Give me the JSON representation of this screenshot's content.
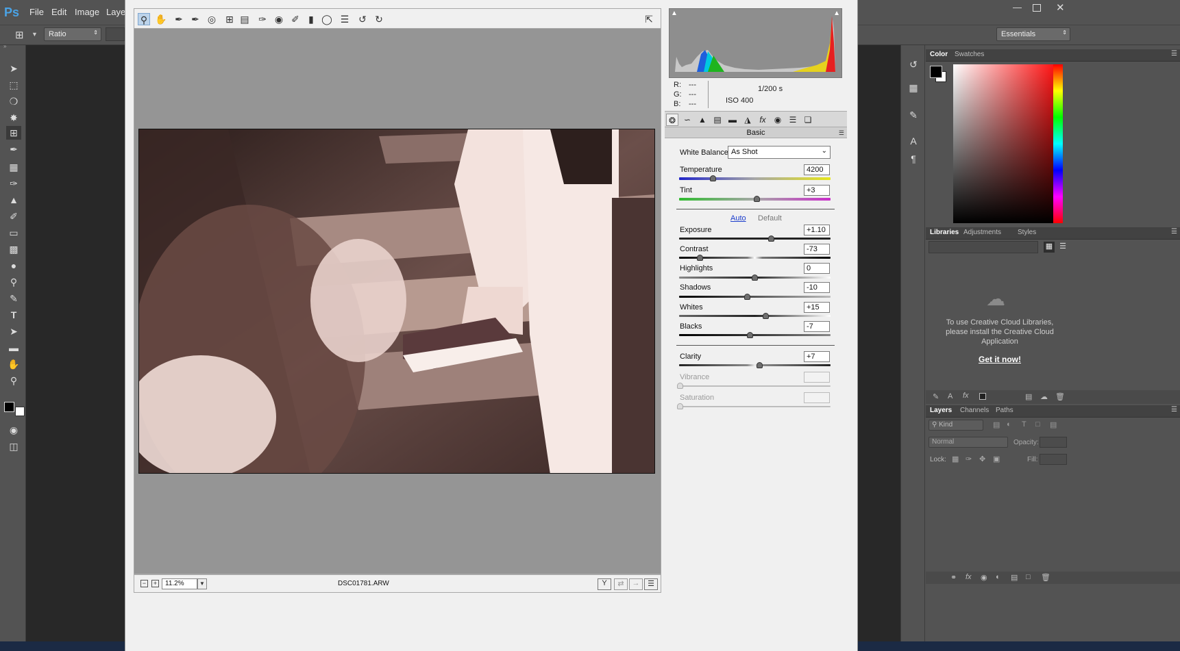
{
  "menu": {
    "items": [
      "File",
      "Edit",
      "Image",
      "Laye"
    ]
  },
  "options": {
    "ratio": "Ratio",
    "workspace": "Essentials"
  },
  "acr": {
    "statusbar": {
      "zoom": "11.2%",
      "filename": "DSC01781.ARW"
    },
    "readout": {
      "r_label": "R:",
      "g_label": "G:",
      "b_label": "B:",
      "r": "---",
      "g": "---",
      "b": "---",
      "shutter": "1/200 s",
      "iso": "ISO 400"
    },
    "panel_title": "Basic",
    "white_balance": {
      "label": "White Balance:",
      "value": "As Shot"
    },
    "auto_label": "Auto",
    "default_label": "Default",
    "controls": [
      {
        "label": "Temperature",
        "value": "4200"
      },
      {
        "label": "Tint",
        "value": "+3"
      },
      {
        "label": "Exposure",
        "value": "+1.10"
      },
      {
        "label": "Contrast",
        "value": "-73"
      },
      {
        "label": "Highlights",
        "value": "0"
      },
      {
        "label": "Shadows",
        "value": "-10"
      },
      {
        "label": "Whites",
        "value": "+15"
      },
      {
        "label": "Blacks",
        "value": "-7"
      },
      {
        "label": "Clarity",
        "value": "+7"
      },
      {
        "label": "Vibrance",
        "value": ""
      },
      {
        "label": "Saturation",
        "value": ""
      }
    ]
  },
  "color_panel": {
    "tabs": [
      "Color",
      "Swatches"
    ]
  },
  "libraries_panel": {
    "tabs": [
      "Libraries",
      "Adjustments",
      "Styles"
    ],
    "message": "To use Creative Cloud Libraries, please install the Creative Cloud Application",
    "cta": "Get it now!"
  },
  "layers_panel": {
    "tabs": [
      "Layers",
      "Channels",
      "Paths"
    ],
    "kind": "Kind",
    "blend_mode": "Normal",
    "opacity_label": "Opacity:",
    "lock_label": "Lock:",
    "fill_label": "Fill:"
  },
  "colors": {
    "ps_bg": "#535353",
    "canvas": "#282828",
    "acr_bg": "#f0f0f0",
    "preview_bg": "#959595",
    "link_blue": "#1a3ccc"
  }
}
